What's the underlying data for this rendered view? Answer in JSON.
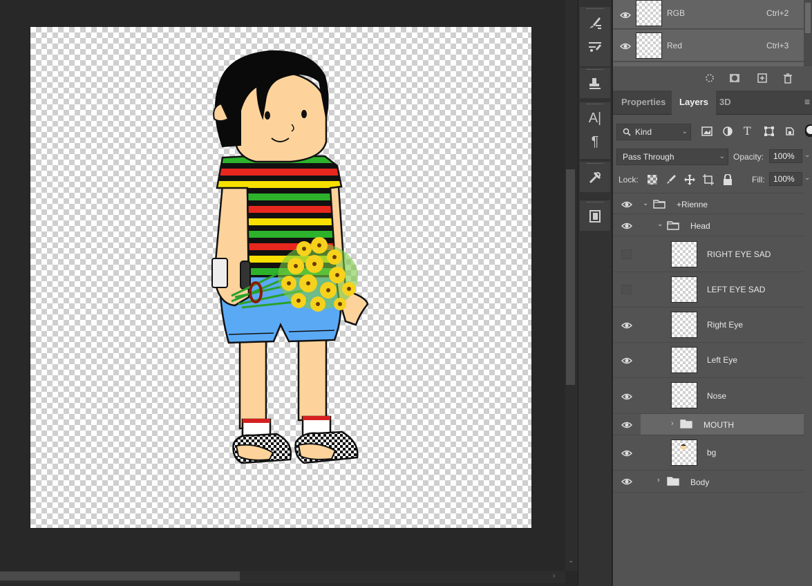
{
  "channels": [
    {
      "name": "RGB",
      "shortcut": "Ctrl+2"
    },
    {
      "name": "Red",
      "shortcut": "Ctrl+3"
    }
  ],
  "panel_tabs": [
    "Properties",
    "Layers",
    "3D"
  ],
  "active_tab": "Layers",
  "filter": {
    "kind_label": "Kind"
  },
  "blend_mode": "Pass Through",
  "opacity": {
    "label": "Opacity:",
    "value": "100%"
  },
  "lock": {
    "label": "Lock:"
  },
  "fill": {
    "label": "Fill:",
    "value": "100%"
  },
  "layers": [
    {
      "name": "+Rienne",
      "type": "group",
      "visible": true,
      "expanded": true
    },
    {
      "name": "Head",
      "type": "group",
      "visible": true,
      "expanded": true
    },
    {
      "name": "RIGHT EYE SAD",
      "type": "layer",
      "visible": false
    },
    {
      "name": "LEFT EYE SAD",
      "type": "layer",
      "visible": false
    },
    {
      "name": "Right Eye",
      "type": "layer",
      "visible": true
    },
    {
      "name": "Left Eye",
      "type": "layer",
      "visible": true
    },
    {
      "name": "Nose",
      "type": "layer",
      "visible": true
    },
    {
      "name": "MOUTH",
      "type": "group",
      "visible": true,
      "expanded": false,
      "selected": true
    },
    {
      "name": "bg",
      "type": "layer",
      "visible": true
    },
    {
      "name": "Body",
      "type": "group",
      "visible": true,
      "expanded": false
    }
  ],
  "canvas": {
    "subject": "cartoon-boy-with-sunflowers",
    "shirt_stripe_colors": [
      "#111111",
      "#e8281e",
      "#f7e000",
      "#2db32b"
    ],
    "skin": "#fdd39b",
    "shorts": "#5aa9f5"
  },
  "colors": {
    "panel_bg": "#535353",
    "selected_layer": "#676767",
    "canvas_bg": "#282828"
  }
}
